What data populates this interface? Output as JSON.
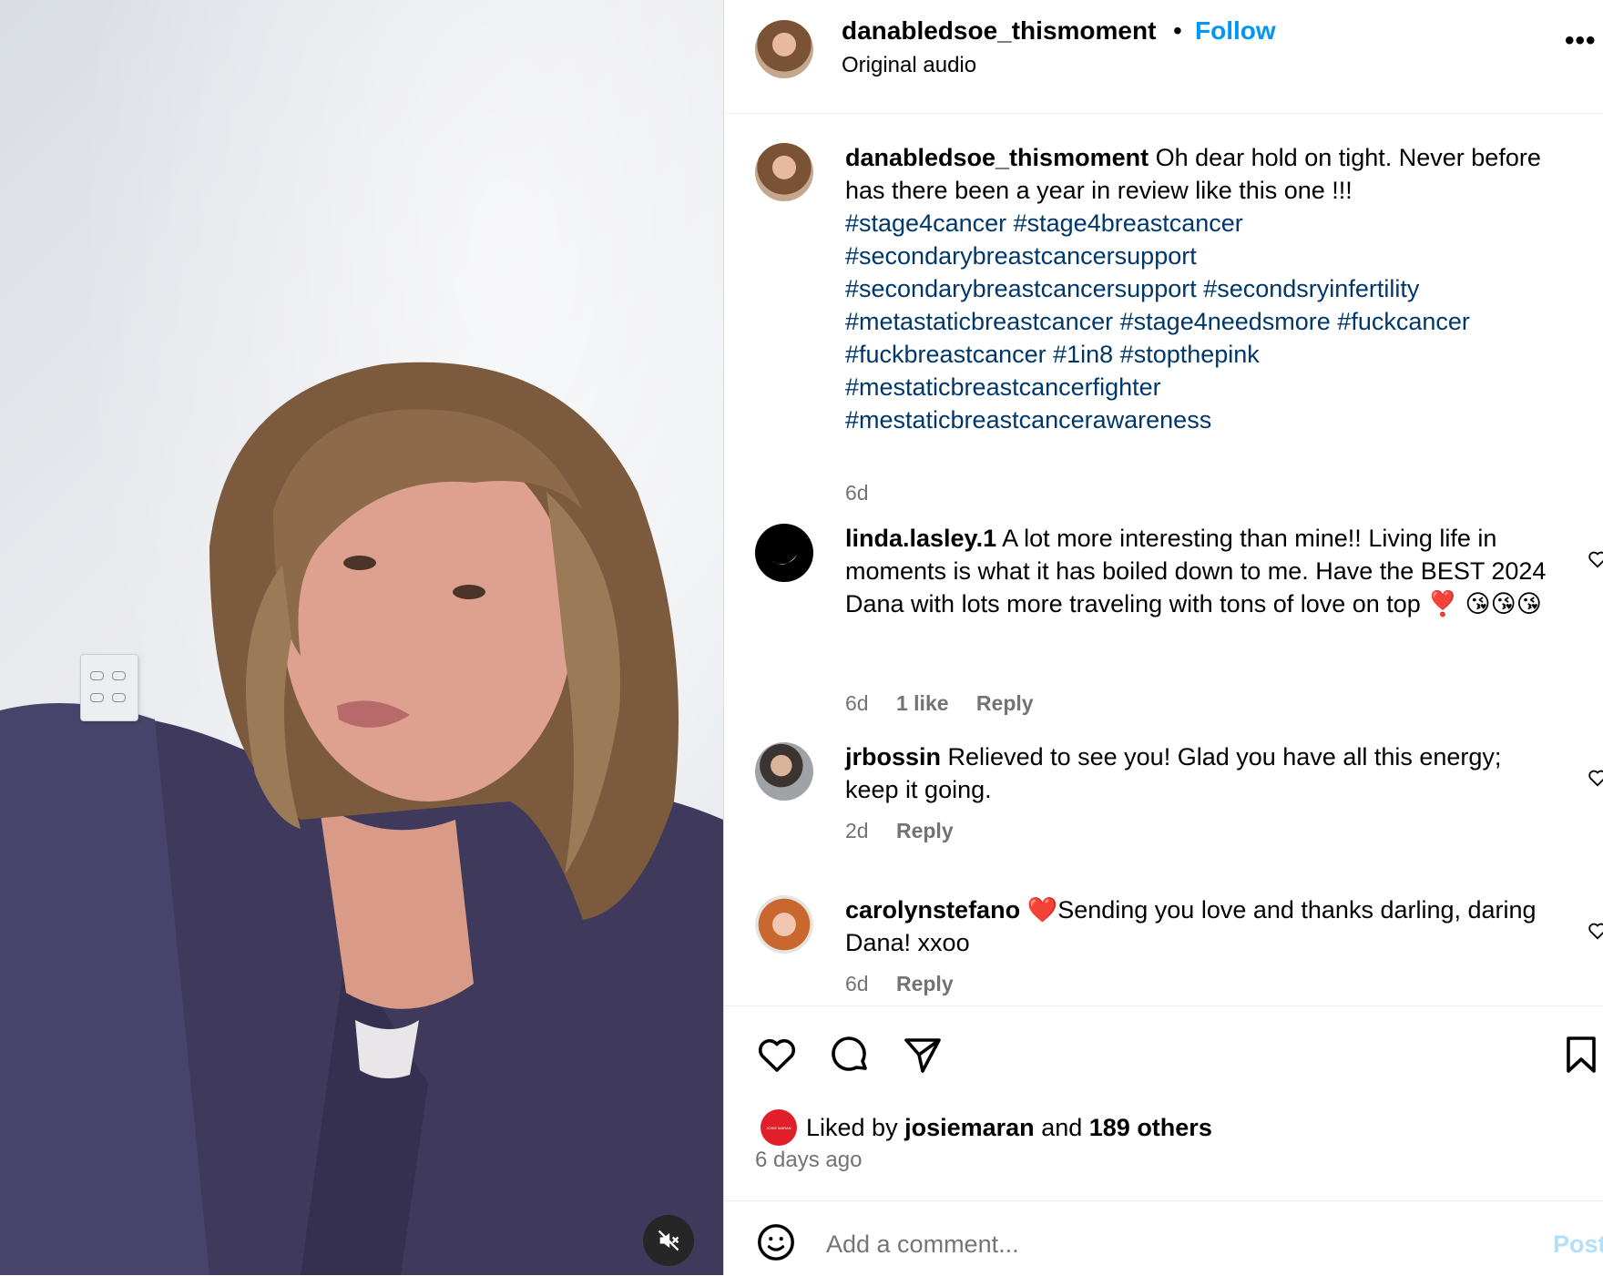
{
  "post": {
    "author": "danabledsoe_thismoment",
    "separator": "•",
    "follow_label": "Follow",
    "audio": "Original audio",
    "more_icon": "more-horizontal-icon"
  },
  "caption": {
    "username": "danabledsoe_thismoment",
    "text": "Oh dear hold on tight. Never before has there been a year in review like this one !!!",
    "hashtags_lines": [
      "#stage4cancer #stage4breastcancer",
      "#secondarybreastcancersupport",
      "#secondarybreastcancersupport #secondsryinfertility",
      "#metastaticbreastcancer #stage4needsmore #fuckcancer",
      "#fuckbreastcancer #1in8 #stopthepink",
      "#mestaticbreastcancerfighter",
      "#mestaticbreastcancerawareness"
    ],
    "time": "6d"
  },
  "comments": [
    {
      "username": "linda.lasley.1",
      "text": "A lot more interesting than mine!! Living life in moments is what it has boiled down to me. Have the BEST 2024 Dana with lots more traveling with tons of love on top ❣️ 😘😘😘",
      "time": "6d",
      "likes": "1 like",
      "reply": "Reply"
    },
    {
      "username": "jrbossin",
      "text": "Relieved to see you! Glad you have all this energy; keep it going.",
      "time": "2d",
      "reply": "Reply"
    },
    {
      "username": "carolynstefano",
      "text": "❤️Sending you love and thanks darling, daring Dana! xxoo",
      "time": "6d",
      "reply": "Reply"
    }
  ],
  "likes": {
    "prefix": "Liked by",
    "user": "josiemaran",
    "middle": "and",
    "others": "189 others",
    "avatar_text": "JOSIE MARAN"
  },
  "time_ago": "6 days ago",
  "comment_box": {
    "placeholder": "Add a comment...",
    "post_label": "Post"
  },
  "colors": {
    "link": "#0095f6",
    "hashtag": "#00376b",
    "muted": "#737373",
    "post_disabled": "#b2dffc"
  }
}
